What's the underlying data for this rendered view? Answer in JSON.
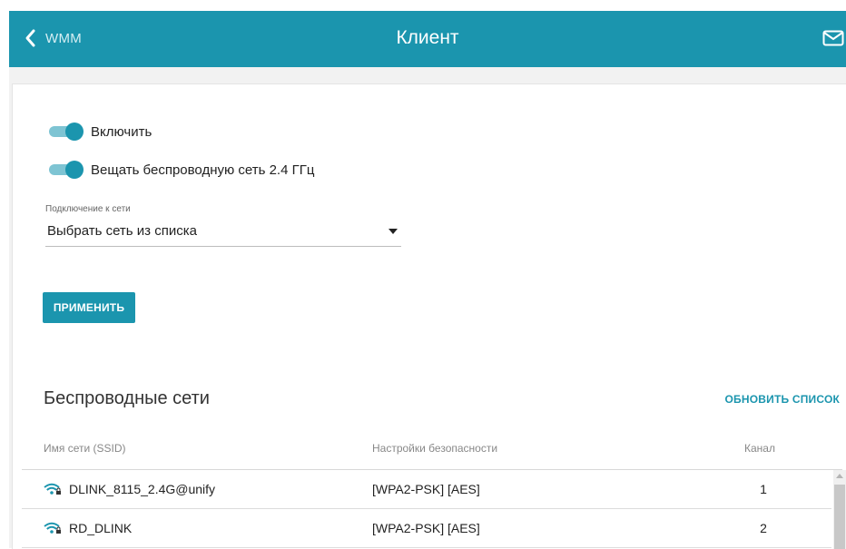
{
  "header": {
    "back_label": "WMM",
    "title": "Клиент"
  },
  "form": {
    "enable_label": "Включить",
    "enable_on": true,
    "broadcast_label": "Вещать беспроводную сеть 2.4 ГГц",
    "broadcast_on": true,
    "connection_label": "Подключение к сети",
    "connection_value": "Выбрать сеть из списка",
    "apply_label": "ПРИМЕНИТЬ"
  },
  "networks": {
    "title": "Беспроводные сети",
    "refresh_label": "ОБНОВИТЬ СПИСОК",
    "columns": [
      "Имя сети (SSID)",
      "Настройки безопасности",
      "Канал"
    ],
    "rows": [
      {
        "ssid": "DLINK_8115_2.4G@unify",
        "security": "[WPA2-PSK] [AES]",
        "channel": "1"
      },
      {
        "ssid": "RD_DLINK",
        "security": "[WPA2-PSK] [AES]",
        "channel": "2"
      }
    ]
  },
  "colors": {
    "accent": "#1b95ae",
    "toggle_track": "#7ec4d3"
  },
  "icons": [
    "chevron-left-icon",
    "mail-icon",
    "wifi-lock-icon",
    "caret-down-icon"
  ]
}
